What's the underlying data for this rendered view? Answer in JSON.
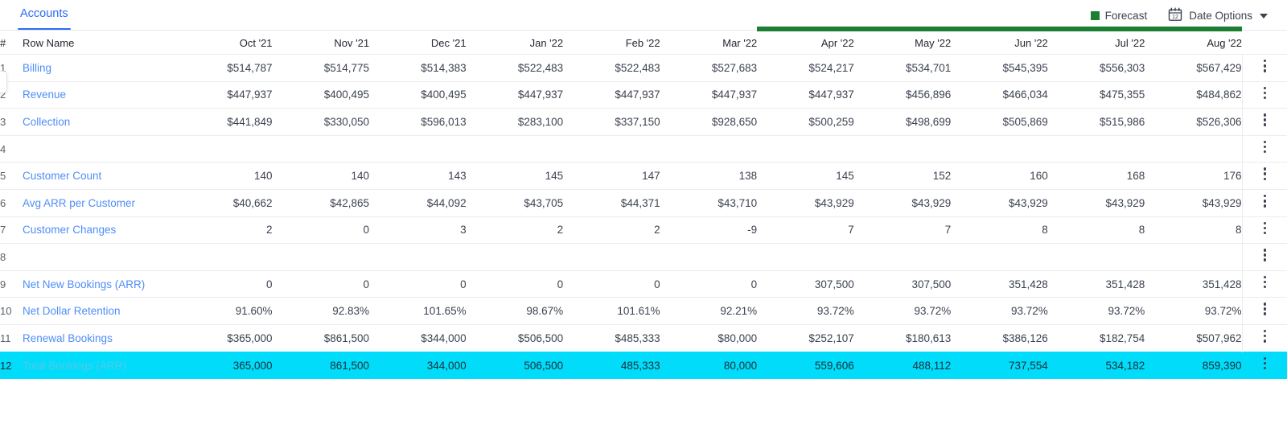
{
  "header": {
    "tabs": [
      {
        "label": "Accounts",
        "active": true
      }
    ],
    "legend": {
      "label": "Forecast",
      "color": "#1b7e32",
      "swatch_icon": "square-swatch-icon"
    },
    "date_options": {
      "label": "Date Options",
      "icon": "calendar-icon",
      "calendar_day": "12",
      "caret_icon": "chevron-down-icon"
    }
  },
  "table": {
    "columns": [
      "#",
      "Row Name",
      "Oct '21",
      "Nov '21",
      "Dec '21",
      "Jan '22",
      "Feb '22",
      "Mar '22",
      "Apr '22",
      "May '22",
      "Jun '22",
      "Jul '22",
      "Aug '22"
    ],
    "forecast_start_column": "Apr '22",
    "forecast_columns": [
      "Apr '22",
      "May '22",
      "Jun '22",
      "Jul '22",
      "Aug '22"
    ],
    "row_menu_icon": "kebab-menu-icon",
    "highlight_color": "#00dcfa",
    "rows": [
      {
        "num": "1",
        "name": "Billing",
        "values": [
          "$514,787",
          "$514,775",
          "$514,383",
          "$522,483",
          "$522,483",
          "$527,683",
          "$524,217",
          "$534,701",
          "$545,395",
          "$556,303",
          "$567,429"
        ]
      },
      {
        "num": "2",
        "name": "Revenue",
        "values": [
          "$447,937",
          "$400,495",
          "$400,495",
          "$447,937",
          "$447,937",
          "$447,937",
          "$447,937",
          "$456,896",
          "$466,034",
          "$475,355",
          "$484,862"
        ]
      },
      {
        "num": "3",
        "name": "Collection",
        "values": [
          "$441,849",
          "$330,050",
          "$596,013",
          "$283,100",
          "$337,150",
          "$928,650",
          "$500,259",
          "$498,699",
          "$505,869",
          "$515,986",
          "$526,306"
        ]
      },
      {
        "num": "4",
        "name": "",
        "values": [
          "",
          "",
          "",
          "",
          "",
          "",
          "",
          "",
          "",
          "",
          ""
        ]
      },
      {
        "num": "5",
        "name": "Customer Count",
        "values": [
          "140",
          "140",
          "143",
          "145",
          "147",
          "138",
          "145",
          "152",
          "160",
          "168",
          "176"
        ]
      },
      {
        "num": "6",
        "name": "Avg ARR per Customer",
        "values": [
          "$40,662",
          "$42,865",
          "$44,092",
          "$43,705",
          "$44,371",
          "$43,710",
          "$43,929",
          "$43,929",
          "$43,929",
          "$43,929",
          "$43,929"
        ]
      },
      {
        "num": "7",
        "name": "Customer Changes",
        "values": [
          "2",
          "0",
          "3",
          "2",
          "2",
          "-9",
          "7",
          "7",
          "8",
          "8",
          "8"
        ]
      },
      {
        "num": "8",
        "name": "",
        "values": [
          "",
          "",
          "",
          "",
          "",
          "",
          "",
          "",
          "",
          "",
          ""
        ]
      },
      {
        "num": "9",
        "name": "Net New Bookings (ARR)",
        "values": [
          "0",
          "0",
          "0",
          "0",
          "0",
          "0",
          "307,500",
          "307,500",
          "351,428",
          "351,428",
          "351,428"
        ]
      },
      {
        "num": "10",
        "name": "Net Dollar Retention",
        "values": [
          "91.60%",
          "92.83%",
          "101.65%",
          "98.67%",
          "101.61%",
          "92.21%",
          "93.72%",
          "93.72%",
          "93.72%",
          "93.72%",
          "93.72%"
        ]
      },
      {
        "num": "11",
        "name": "Renewal Bookings",
        "values": [
          "$365,000",
          "$861,500",
          "$344,000",
          "$506,500",
          "$485,333",
          "$80,000",
          "$252,107",
          "$180,613",
          "$386,126",
          "$182,754",
          "$507,962"
        ]
      },
      {
        "num": "12",
        "name": "Total Bookings (ARR)",
        "highlight": true,
        "values": [
          "365,000",
          "861,500",
          "344,000",
          "506,500",
          "485,333",
          "80,000",
          "559,606",
          "488,112",
          "737,554",
          "534,182",
          "859,390"
        ]
      }
    ]
  }
}
